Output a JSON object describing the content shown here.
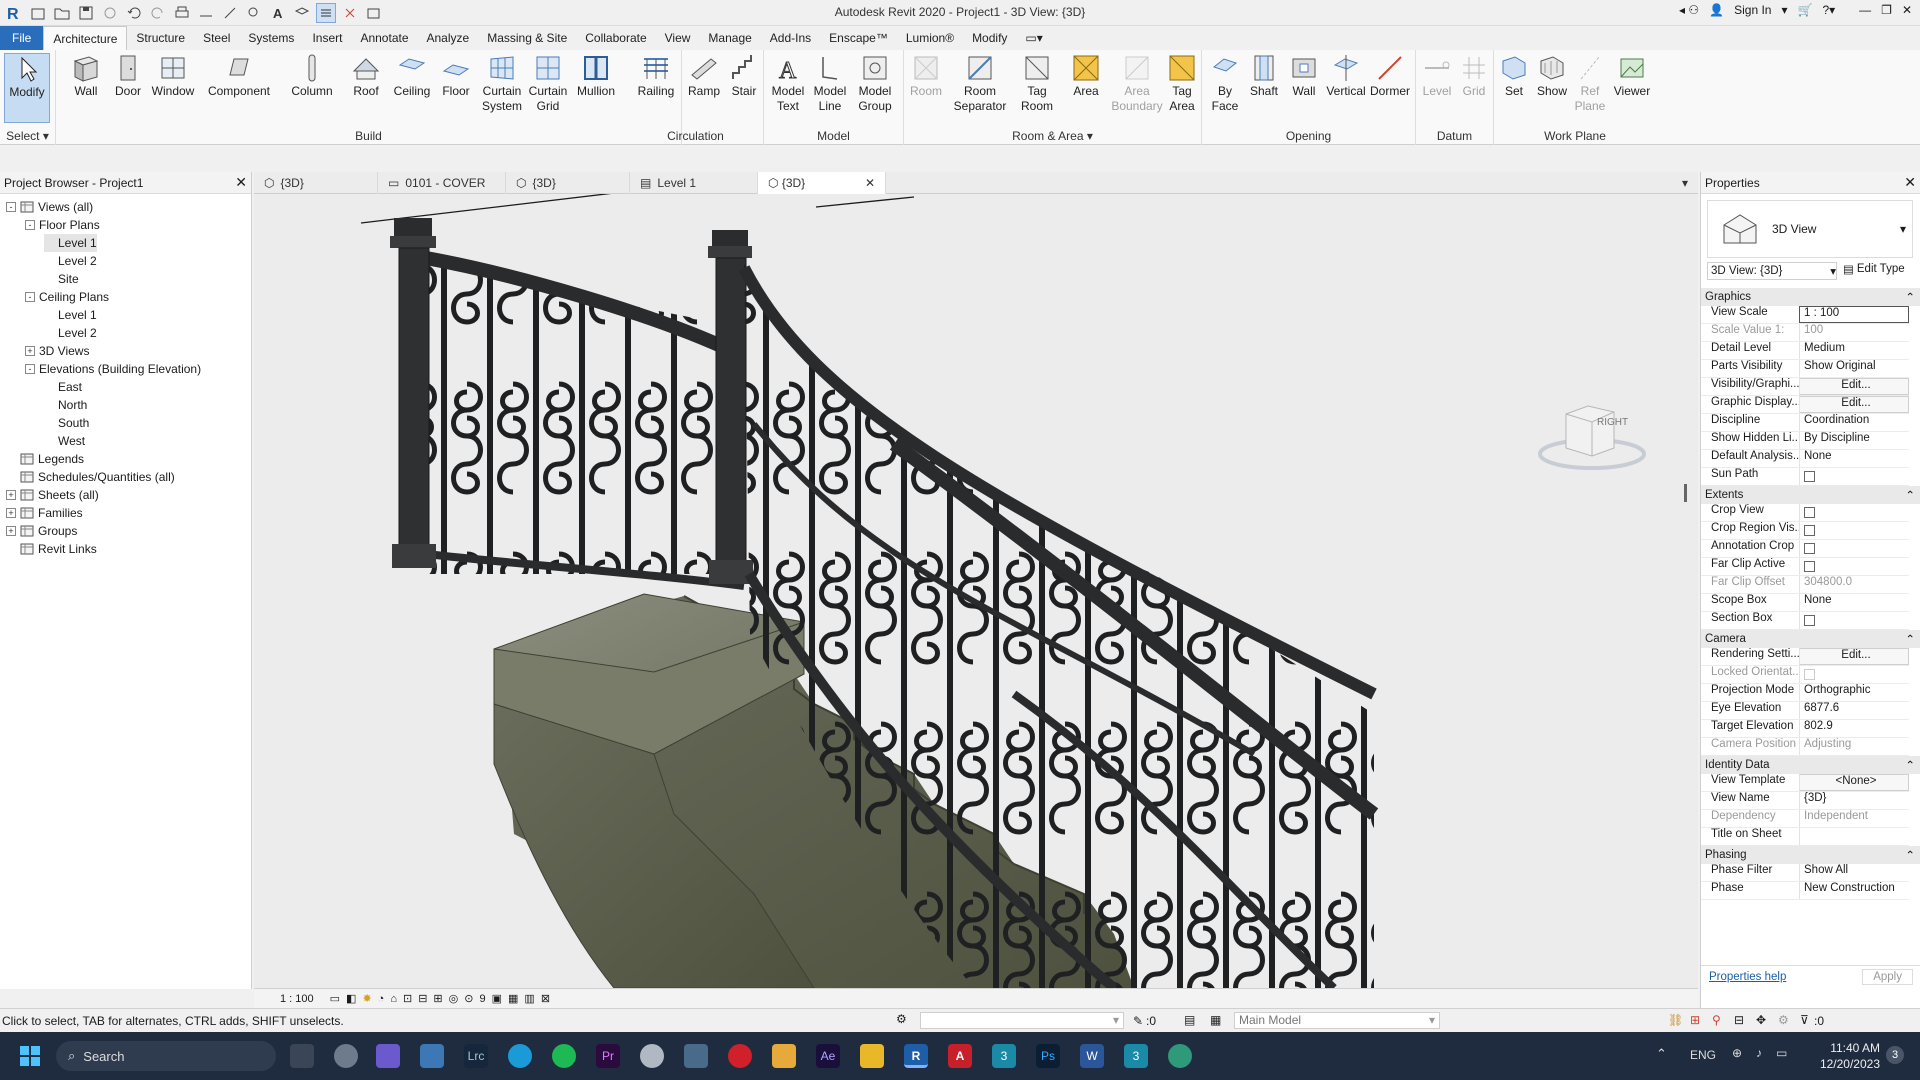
{
  "titlebar": {
    "title": "Autodesk Revit 2020 - Project1 - 3D View: {3D}",
    "sign_in": "Sign In"
  },
  "menu": {
    "tabs": [
      "File",
      "Architecture",
      "Structure",
      "Steel",
      "Systems",
      "Insert",
      "Annotate",
      "Analyze",
      "Massing & Site",
      "Collaborate",
      "View",
      "Manage",
      "Add-Ins",
      "Enscape™",
      "Lumion®",
      "Modify"
    ]
  },
  "ribbon": {
    "select": {
      "modify": "Modify",
      "label": "Select"
    },
    "build": {
      "label": "Build",
      "buttons": [
        "Wall",
        "Door",
        "Window",
        "Component",
        "Column",
        "Roof",
        "Ceiling",
        "Floor",
        "Curtain System",
        "Curtain Grid",
        "Mullion"
      ]
    },
    "circulation": {
      "label": "Circulation",
      "buttons": [
        "Railing",
        "Ramp",
        "Stair"
      ]
    },
    "model": {
      "label": "Model",
      "buttons": [
        "Model Text",
        "Model Line",
        "Model Group"
      ]
    },
    "room_area": {
      "label": "Room & Area",
      "buttons": [
        "Room",
        "Room Separator",
        "Tag Room",
        "Area",
        "Area Boundary",
        "Tag Area"
      ]
    },
    "opening": {
      "label": "Opening",
      "buttons": [
        "By Face",
        "Shaft",
        "Wall",
        "Vertical",
        "Dormer"
      ]
    },
    "datum": {
      "label": "Datum",
      "buttons": [
        "Level",
        "Grid"
      ]
    },
    "work_plane": {
      "label": "Work Plane",
      "buttons": [
        "Set",
        "Show",
        "Ref Plane",
        "Viewer"
      ]
    }
  },
  "browser": {
    "title": "Project Browser - Project1",
    "items": [
      {
        "label": "Views (all)",
        "level": 0,
        "toggle": "-"
      },
      {
        "label": "Floor Plans",
        "level": 1,
        "toggle": "-"
      },
      {
        "label": "Level 1",
        "level": 2,
        "toggle": "",
        "selected": true
      },
      {
        "label": "Level 2",
        "level": 2,
        "toggle": ""
      },
      {
        "label": "Site",
        "level": 2,
        "toggle": ""
      },
      {
        "label": "Ceiling Plans",
        "level": 1,
        "toggle": "-"
      },
      {
        "label": "Level 1",
        "level": 2,
        "toggle": ""
      },
      {
        "label": "Level 2",
        "level": 2,
        "toggle": ""
      },
      {
        "label": "3D Views",
        "level": 1,
        "toggle": "+"
      },
      {
        "label": "Elevations (Building Elevation)",
        "level": 1,
        "toggle": "-"
      },
      {
        "label": "East",
        "level": 2,
        "toggle": ""
      },
      {
        "label": "North",
        "level": 2,
        "toggle": ""
      },
      {
        "label": "South",
        "level": 2,
        "toggle": ""
      },
      {
        "label": "West",
        "level": 2,
        "toggle": ""
      },
      {
        "label": "Legends",
        "level": 0,
        "toggle": ""
      },
      {
        "label": "Schedules/Quantities (all)",
        "level": 0,
        "toggle": ""
      },
      {
        "label": "Sheets (all)",
        "level": 0,
        "toggle": "+"
      },
      {
        "label": "Families",
        "level": 0,
        "toggle": "+"
      },
      {
        "label": "Groups",
        "level": 0,
        "toggle": "+"
      },
      {
        "label": "Revit Links",
        "level": 0,
        "toggle": ""
      }
    ]
  },
  "view_tabs": [
    "{3D}",
    "0101 - COVER",
    "{3D}",
    "Level 1",
    "{3D}"
  ],
  "viewcube_label": "RIGHT",
  "view_scale_bar": "1 : 100",
  "properties": {
    "title": "Properties",
    "type_name": "3D View",
    "selector": "3D View: {3D}",
    "edit_type": "Edit Type",
    "sections": [
      {
        "name": "Graphics",
        "rows": [
          {
            "k": "View Scale",
            "v": "1 : 100"
          },
          {
            "k": "Scale Value    1:",
            "v": "100",
            "dis": true
          },
          {
            "k": "Detail Level",
            "v": "Medium"
          },
          {
            "k": "Parts Visibility",
            "v": "Show Original"
          },
          {
            "k": "Visibility/Graphi...",
            "v": "Edit...",
            "btn": true
          },
          {
            "k": "Graphic Display...",
            "v": "Edit...",
            "btn": true
          },
          {
            "k": "Discipline",
            "v": "Coordination"
          },
          {
            "k": "Show Hidden Li...",
            "v": "By Discipline"
          },
          {
            "k": "Default Analysis...",
            "v": "None"
          },
          {
            "k": "Sun Path",
            "v": "",
            "chk": true
          }
        ]
      },
      {
        "name": "Extents",
        "rows": [
          {
            "k": "Crop View",
            "v": "",
            "chk": true
          },
          {
            "k": "Crop Region Vis...",
            "v": "",
            "chk": true
          },
          {
            "k": "Annotation Crop",
            "v": "",
            "chk": true
          },
          {
            "k": "Far Clip Active",
            "v": "",
            "chk": true
          },
          {
            "k": "Far Clip Offset",
            "v": "304800.0",
            "dis": true
          },
          {
            "k": "Scope Box",
            "v": "None"
          },
          {
            "k": "Section Box",
            "v": "",
            "chk": true
          }
        ]
      },
      {
        "name": "Camera",
        "rows": [
          {
            "k": "Rendering Setti...",
            "v": "Edit...",
            "btn": true
          },
          {
            "k": "Locked Orientat...",
            "v": "",
            "chk": true,
            "dis": true
          },
          {
            "k": "Projection Mode",
            "v": "Orthographic"
          },
          {
            "k": "Eye Elevation",
            "v": "6877.6"
          },
          {
            "k": "Target Elevation",
            "v": "802.9"
          },
          {
            "k": "Camera Position",
            "v": "Adjusting",
            "dis": true
          }
        ]
      },
      {
        "name": "Identity Data",
        "rows": [
          {
            "k": "View Template",
            "v": "<None>",
            "btn": true
          },
          {
            "k": "View Name",
            "v": "{3D}"
          },
          {
            "k": "Dependency",
            "v": "Independent",
            "dis": true
          },
          {
            "k": "Title on Sheet",
            "v": ""
          }
        ]
      },
      {
        "name": "Phasing",
        "rows": [
          {
            "k": "Phase Filter",
            "v": "Show All"
          },
          {
            "k": "Phase",
            "v": "New Construction"
          }
        ]
      }
    ],
    "help": "Properties help",
    "apply": "Apply"
  },
  "status": {
    "hint": "Click to select, TAB for alternates, CTRL adds, SHIFT unselects.",
    "zero": ":0",
    "model": "Main Model",
    "filter_count": ":0"
  },
  "taskbar": {
    "search": "Search",
    "lang": "ENG",
    "time": "11:40 AM",
    "date": "12/20/2023",
    "badge": "3"
  }
}
